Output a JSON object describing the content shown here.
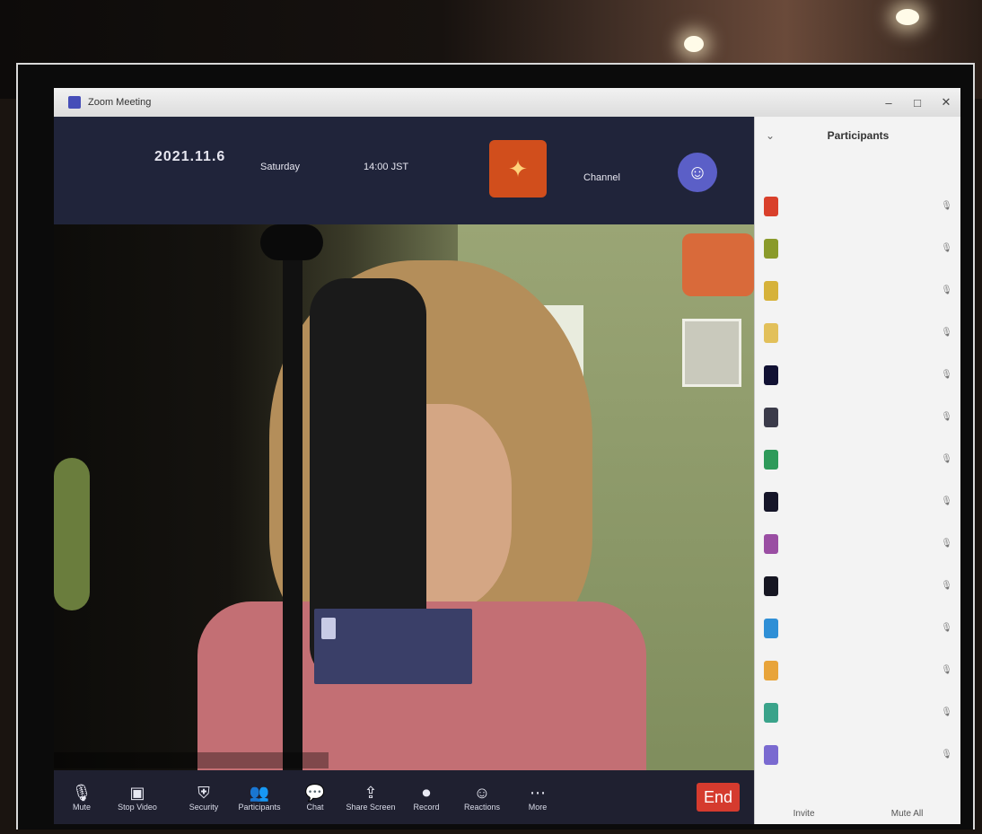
{
  "window": {
    "title": "Zoom Meeting",
    "controls": [
      "–",
      "□",
      "✕"
    ]
  },
  "header": {
    "date": "2021.11.6",
    "date_sub": "",
    "item2": "Saturday",
    "item3": "14:00 JST",
    "logo_glyph": "✦",
    "item4": "Channel",
    "person_icon": "person-icon",
    "row2": ""
  },
  "popup": {
    "title": "",
    "action": ""
  },
  "caption": "",
  "toolbar": {
    "buttons": [
      {
        "icon": "microphone-icon",
        "glyph": "🎙",
        "label": "Mute"
      },
      {
        "icon": "video-icon",
        "glyph": "▣",
        "label": "Stop Video"
      },
      {
        "icon": "security-icon",
        "glyph": "⛨",
        "label": "Security"
      },
      {
        "icon": "participants-icon",
        "glyph": "👥",
        "label": "Participants"
      },
      {
        "icon": "chat-icon",
        "glyph": "💬",
        "label": "Chat"
      },
      {
        "icon": "share-icon",
        "glyph": "⇪",
        "label": "Share Screen"
      },
      {
        "icon": "record-icon",
        "glyph": "⏺",
        "label": "Record"
      },
      {
        "icon": "reactions-icon",
        "glyph": "☺",
        "label": "Reactions"
      },
      {
        "icon": "more-icon",
        "glyph": "⋯",
        "label": "More"
      }
    ],
    "leave_label": "End",
    "accent": "#d53b2e"
  },
  "panel": {
    "title": "Participants",
    "search_placeholder": "",
    "participants": [
      {
        "name": "",
        "color": "#d9402b"
      },
      {
        "name": "",
        "color": "#8a9a2b"
      },
      {
        "name": "",
        "color": "#d6b23a"
      },
      {
        "name": "",
        "color": "#e2c05a"
      },
      {
        "name": "",
        "color": "#111133"
      },
      {
        "name": "",
        "color": "#3b3b4a"
      },
      {
        "name": "",
        "color": "#2e9a5a"
      },
      {
        "name": "",
        "color": "#151528"
      },
      {
        "name": "",
        "color": "#9a4ea3"
      },
      {
        "name": "",
        "color": "#161622"
      },
      {
        "name": "",
        "color": "#2f8fd6"
      },
      {
        "name": "",
        "color": "#e8a43a"
      },
      {
        "name": "",
        "color": "#3aa38a"
      },
      {
        "name": "",
        "color": "#7a6ad0"
      }
    ],
    "footer": [
      "Invite",
      "Mute All"
    ]
  }
}
